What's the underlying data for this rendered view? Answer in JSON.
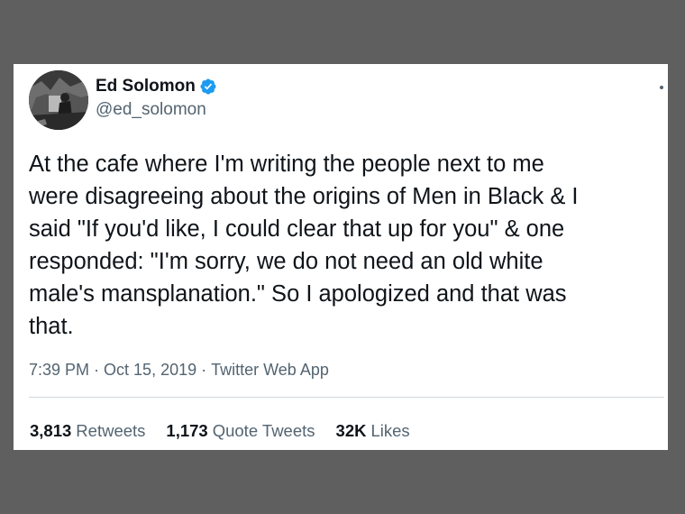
{
  "tweet": {
    "author": {
      "display_name": "Ed Solomon",
      "handle": "@ed_solomon",
      "verified": true,
      "verified_icon": "verified-badge-icon",
      "avatar_icon": "profile-photo"
    },
    "text": "At the cafe where I'm writing the people next to me\nwere disagreeing about the origins of Men in Black & I\nsaid \"If you'd like, I could clear that up for you\" & one\nresponded: \"I'm sorry, we do not need an old white\nmale's mansplanation.\" So I apologized and that was\nthat.",
    "time": "7:39 PM",
    "separator": "·",
    "date": "Oct 15, 2019",
    "source": "Twitter Web App",
    "stats": [
      {
        "count": "3,813",
        "label": "Retweets"
      },
      {
        "count": "1,173",
        "label": "Quote Tweets"
      },
      {
        "count": "32K",
        "label": "Likes"
      }
    ]
  },
  "colors": {
    "background": "#5f5f5f",
    "card": "#ffffff",
    "text_primary": "#0f1419",
    "text_secondary": "#536471",
    "verified_blue": "#1d9bf0",
    "divider": "#cfd9de"
  }
}
